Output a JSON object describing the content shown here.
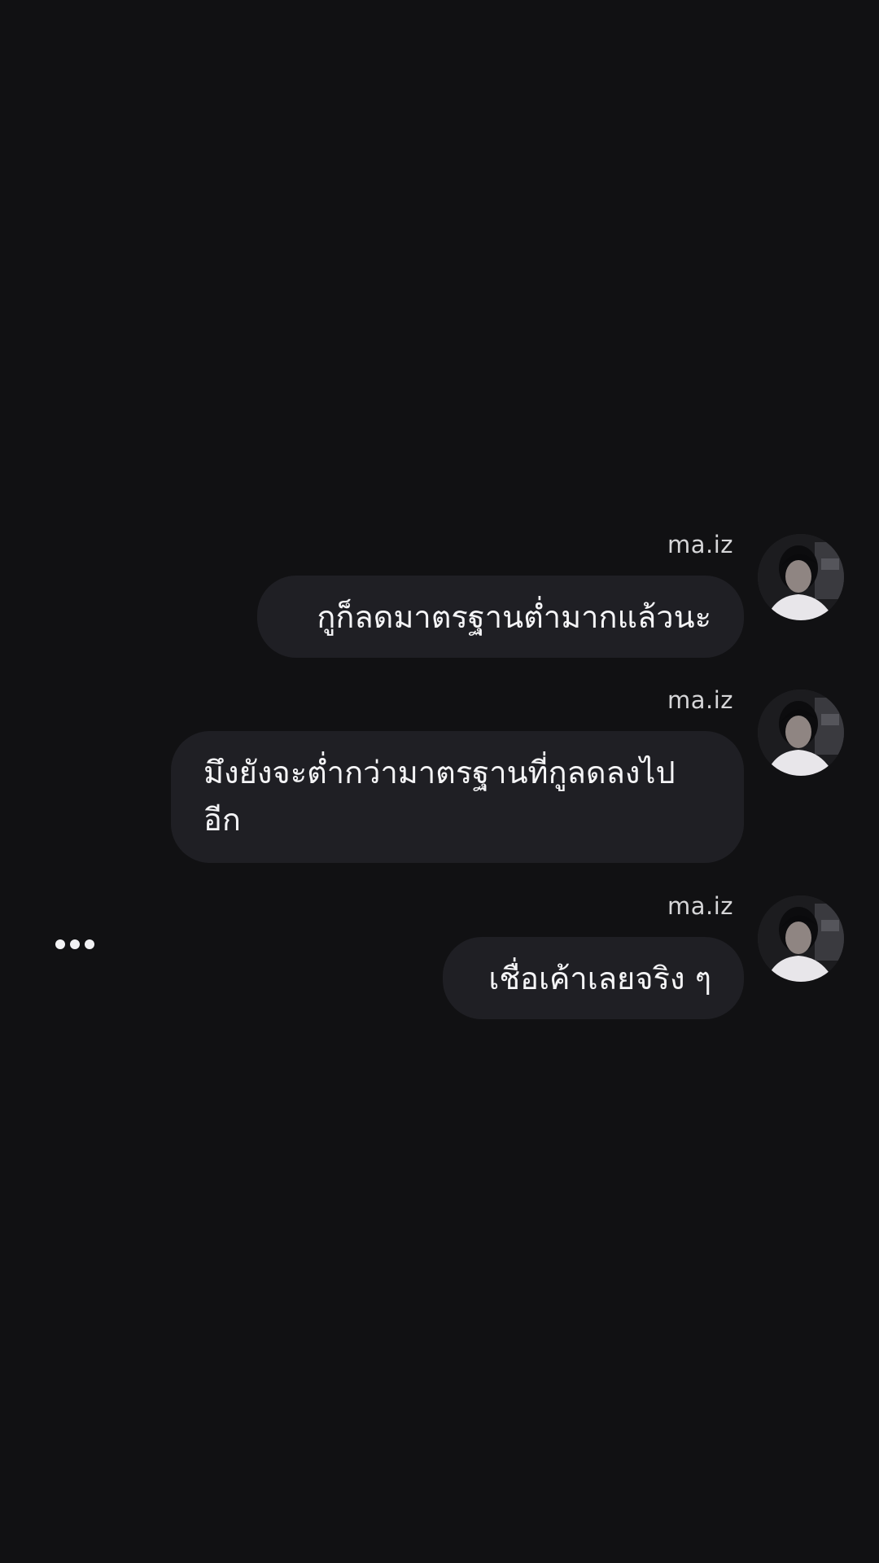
{
  "messages": [
    {
      "sender": "ma.iz",
      "text": "กูก็ลดมาตรฐานต่ำมากแล้วนะ"
    },
    {
      "sender": "ma.iz",
      "text_line1": "มึงยังจะต่ำกว่ามาตรฐานที่กูลดลงไป",
      "text_line2": "อีก"
    },
    {
      "sender": "ma.iz",
      "text": "เชื่อเค้าเลยจริง ๆ"
    }
  ],
  "more_icon": "more-horizontal-icon",
  "colors": {
    "background": "#111113",
    "bubble": "#1f1f24",
    "text": "#f4f4f6",
    "sender": "#d6d6d8"
  }
}
